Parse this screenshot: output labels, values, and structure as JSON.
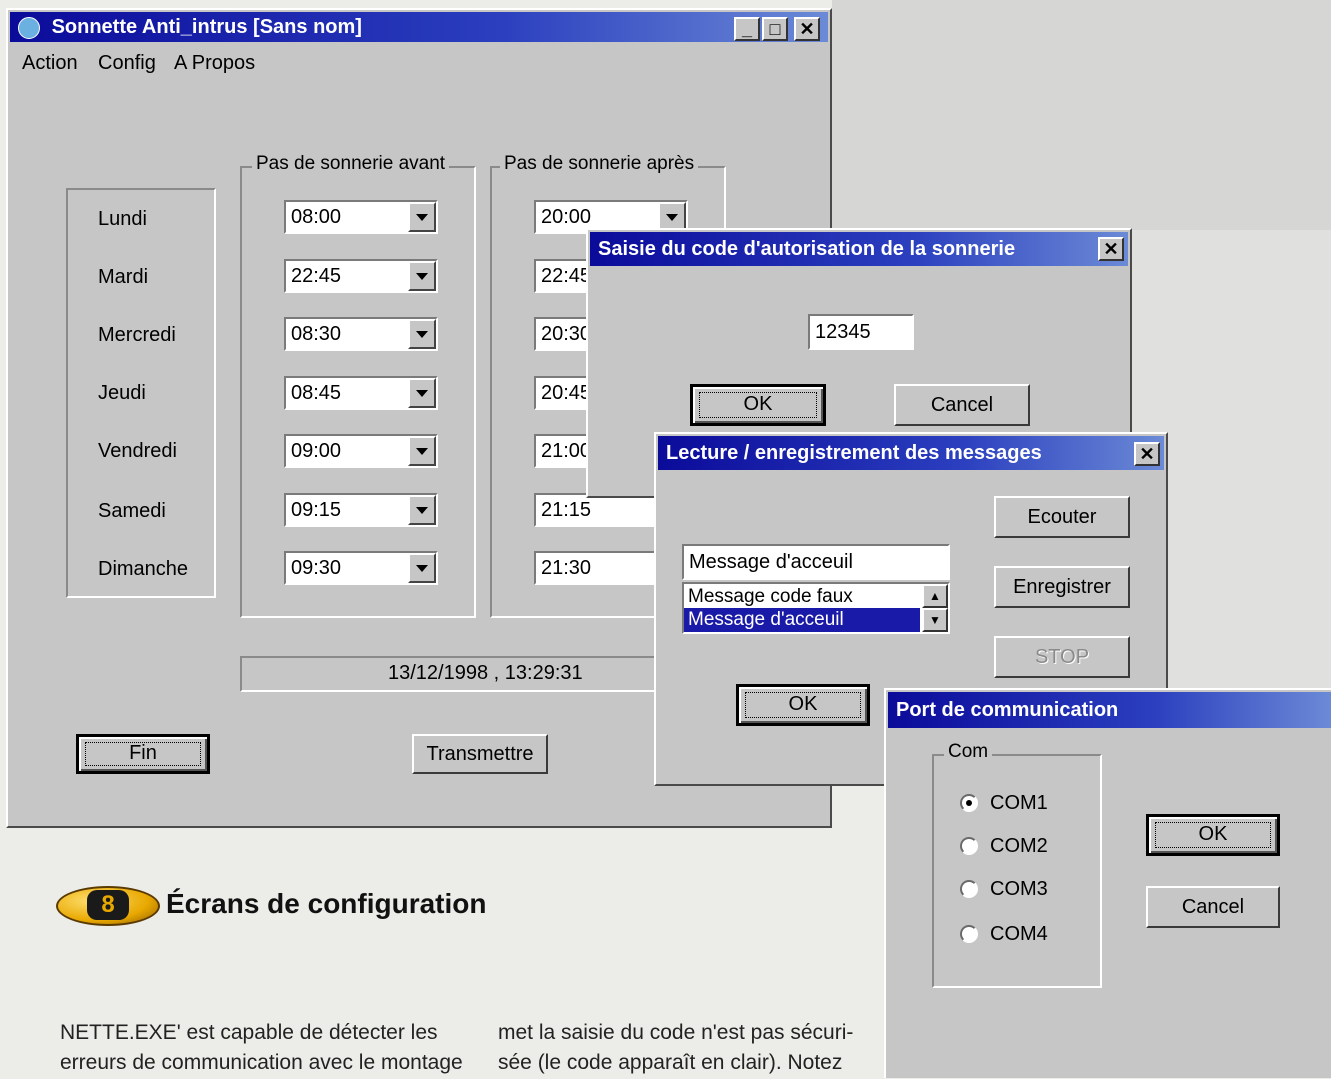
{
  "main_window": {
    "title": "Sonnette Anti_intrus [Sans nom]",
    "menu": [
      "Action",
      "Config",
      "A Propos"
    ],
    "group_before": "Pas de sonnerie avant",
    "group_after": "Pas de sonnerie après",
    "days": [
      "Lundi",
      "Mardi",
      "Mercredi",
      "Jeudi",
      "Vendredi",
      "Samedi",
      "Dimanche"
    ],
    "before_times": [
      "08:00",
      "22:45",
      "08:30",
      "08:45",
      "09:00",
      "09:15",
      "09:30"
    ],
    "after_times": [
      "20:00",
      "22:45",
      "20:30",
      "20:45",
      "21:00",
      "21:15",
      "21:30"
    ],
    "status": "13/12/1998 , 13:29:31",
    "btn_fin": "Fin",
    "btn_transmettre": "Transmettre"
  },
  "code_dialog": {
    "title": "Saisie du code d'autorisation de la sonnerie",
    "code_value": "12345",
    "ok": "OK",
    "cancel": "Cancel"
  },
  "messages_dialog": {
    "title": "Lecture / enregistrement des messages",
    "combo_value": "Message d'acceuil",
    "list_items": [
      "Message code faux",
      "Message d'acceuil"
    ],
    "selected_index": 1,
    "btn_ecouter": "Ecouter",
    "btn_enregistrer": "Enregistrer",
    "btn_stop": "STOP",
    "ok": "OK"
  },
  "port_dialog": {
    "title": "Port de communication",
    "group": "Com",
    "options": [
      "COM1",
      "COM2",
      "COM3",
      "COM4"
    ],
    "selected": "COM1",
    "ok": "OK",
    "cancel": "Cancel"
  },
  "article": {
    "badge_number": "8",
    "heading": "Écrans de configuration",
    "col1_line1": "NETTE.EXE' est capable de détecter les",
    "col1_line2": "erreurs de communication avec le montage",
    "col2_line1": "met la saisie du code n'est pas sécuri-",
    "col2_line2": "sée (le code apparaît en clair). Notez"
  },
  "colors": {
    "titlebar": "#0b0b9a",
    "window_face": "#c6c6c6",
    "selection": "#1a1aa8",
    "badge": "#e8a800"
  }
}
